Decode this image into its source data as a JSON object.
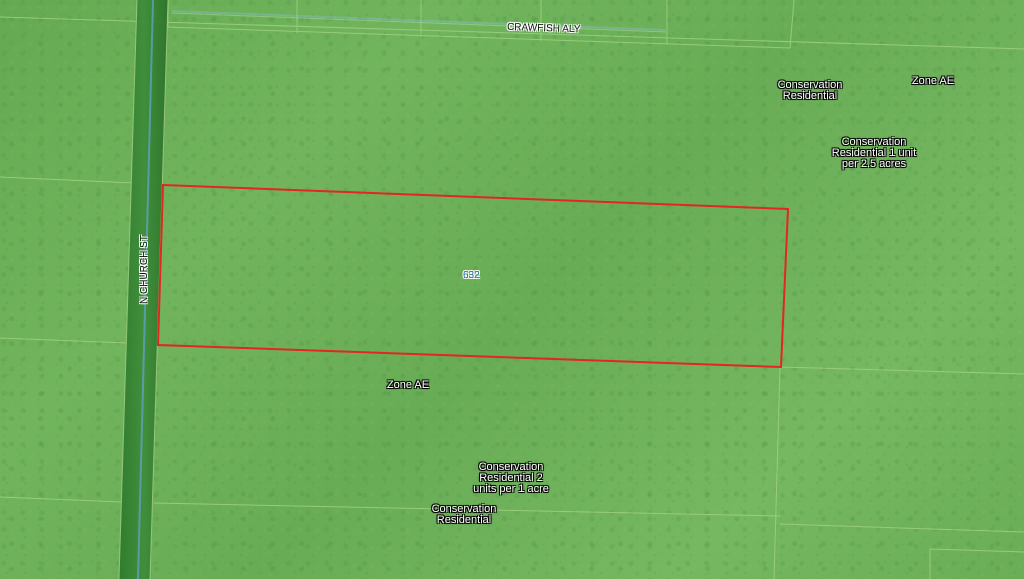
{
  "map": {
    "road_labels": {
      "crawfish": "CRAWFISH ALY",
      "church": "N CHURCH ST"
    },
    "parcel_number": "632",
    "zone_labels": [
      "Conservation\nResidential",
      "Zone AE",
      "Conservation\nResidential 1 unit\nper 2.5 acres",
      "Zone AE",
      "Conservation\nResidential 2\nunits per 1 acre",
      "Conservation\nResidential"
    ],
    "colors": {
      "map_green": "#6fb35a",
      "parcel_outline": "#e3261f",
      "road_green": "#2f7d2f",
      "road_blue_line": "#65a3c8"
    }
  }
}
